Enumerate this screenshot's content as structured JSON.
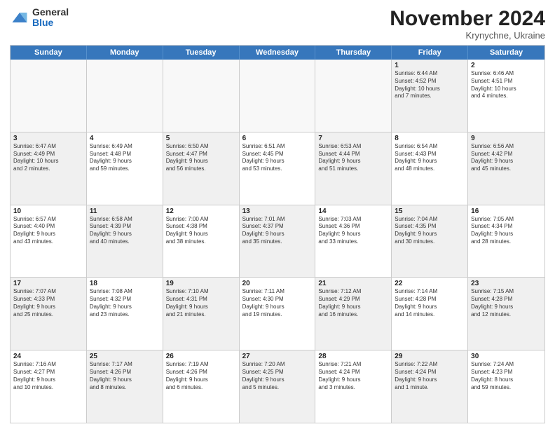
{
  "logo": {
    "general": "General",
    "blue": "Blue"
  },
  "header": {
    "month": "November 2024",
    "location": "Krynychne, Ukraine"
  },
  "days": [
    "Sunday",
    "Monday",
    "Tuesday",
    "Wednesday",
    "Thursday",
    "Friday",
    "Saturday"
  ],
  "rows": [
    [
      {
        "day": "",
        "info": "",
        "empty": true
      },
      {
        "day": "",
        "info": "",
        "empty": true
      },
      {
        "day": "",
        "info": "",
        "empty": true
      },
      {
        "day": "",
        "info": "",
        "empty": true
      },
      {
        "day": "",
        "info": "",
        "empty": true
      },
      {
        "day": "1",
        "info": "Sunrise: 6:44 AM\nSunset: 4:52 PM\nDaylight: 10 hours\nand 7 minutes.",
        "shaded": true
      },
      {
        "day": "2",
        "info": "Sunrise: 6:46 AM\nSunset: 4:51 PM\nDaylight: 10 hours\nand 4 minutes.",
        "shaded": false
      }
    ],
    [
      {
        "day": "3",
        "info": "Sunrise: 6:47 AM\nSunset: 4:49 PM\nDaylight: 10 hours\nand 2 minutes.",
        "shaded": true
      },
      {
        "day": "4",
        "info": "Sunrise: 6:49 AM\nSunset: 4:48 PM\nDaylight: 9 hours\nand 59 minutes.",
        "shaded": false
      },
      {
        "day": "5",
        "info": "Sunrise: 6:50 AM\nSunset: 4:47 PM\nDaylight: 9 hours\nand 56 minutes.",
        "shaded": true
      },
      {
        "day": "6",
        "info": "Sunrise: 6:51 AM\nSunset: 4:45 PM\nDaylight: 9 hours\nand 53 minutes.",
        "shaded": false
      },
      {
        "day": "7",
        "info": "Sunrise: 6:53 AM\nSunset: 4:44 PM\nDaylight: 9 hours\nand 51 minutes.",
        "shaded": true
      },
      {
        "day": "8",
        "info": "Sunrise: 6:54 AM\nSunset: 4:43 PM\nDaylight: 9 hours\nand 48 minutes.",
        "shaded": false
      },
      {
        "day": "9",
        "info": "Sunrise: 6:56 AM\nSunset: 4:42 PM\nDaylight: 9 hours\nand 45 minutes.",
        "shaded": true
      }
    ],
    [
      {
        "day": "10",
        "info": "Sunrise: 6:57 AM\nSunset: 4:40 PM\nDaylight: 9 hours\nand 43 minutes.",
        "shaded": false
      },
      {
        "day": "11",
        "info": "Sunrise: 6:58 AM\nSunset: 4:39 PM\nDaylight: 9 hours\nand 40 minutes.",
        "shaded": true
      },
      {
        "day": "12",
        "info": "Sunrise: 7:00 AM\nSunset: 4:38 PM\nDaylight: 9 hours\nand 38 minutes.",
        "shaded": false
      },
      {
        "day": "13",
        "info": "Sunrise: 7:01 AM\nSunset: 4:37 PM\nDaylight: 9 hours\nand 35 minutes.",
        "shaded": true
      },
      {
        "day": "14",
        "info": "Sunrise: 7:03 AM\nSunset: 4:36 PM\nDaylight: 9 hours\nand 33 minutes.",
        "shaded": false
      },
      {
        "day": "15",
        "info": "Sunrise: 7:04 AM\nSunset: 4:35 PM\nDaylight: 9 hours\nand 30 minutes.",
        "shaded": true
      },
      {
        "day": "16",
        "info": "Sunrise: 7:05 AM\nSunset: 4:34 PM\nDaylight: 9 hours\nand 28 minutes.",
        "shaded": false
      }
    ],
    [
      {
        "day": "17",
        "info": "Sunrise: 7:07 AM\nSunset: 4:33 PM\nDaylight: 9 hours\nand 25 minutes.",
        "shaded": true
      },
      {
        "day": "18",
        "info": "Sunrise: 7:08 AM\nSunset: 4:32 PM\nDaylight: 9 hours\nand 23 minutes.",
        "shaded": false
      },
      {
        "day": "19",
        "info": "Sunrise: 7:10 AM\nSunset: 4:31 PM\nDaylight: 9 hours\nand 21 minutes.",
        "shaded": true
      },
      {
        "day": "20",
        "info": "Sunrise: 7:11 AM\nSunset: 4:30 PM\nDaylight: 9 hours\nand 19 minutes.",
        "shaded": false
      },
      {
        "day": "21",
        "info": "Sunrise: 7:12 AM\nSunset: 4:29 PM\nDaylight: 9 hours\nand 16 minutes.",
        "shaded": true
      },
      {
        "day": "22",
        "info": "Sunrise: 7:14 AM\nSunset: 4:28 PM\nDaylight: 9 hours\nand 14 minutes.",
        "shaded": false
      },
      {
        "day": "23",
        "info": "Sunrise: 7:15 AM\nSunset: 4:28 PM\nDaylight: 9 hours\nand 12 minutes.",
        "shaded": true
      }
    ],
    [
      {
        "day": "24",
        "info": "Sunrise: 7:16 AM\nSunset: 4:27 PM\nDaylight: 9 hours\nand 10 minutes.",
        "shaded": false
      },
      {
        "day": "25",
        "info": "Sunrise: 7:17 AM\nSunset: 4:26 PM\nDaylight: 9 hours\nand 8 minutes.",
        "shaded": true
      },
      {
        "day": "26",
        "info": "Sunrise: 7:19 AM\nSunset: 4:26 PM\nDaylight: 9 hours\nand 6 minutes.",
        "shaded": false
      },
      {
        "day": "27",
        "info": "Sunrise: 7:20 AM\nSunset: 4:25 PM\nDaylight: 9 hours\nand 5 minutes.",
        "shaded": true
      },
      {
        "day": "28",
        "info": "Sunrise: 7:21 AM\nSunset: 4:24 PM\nDaylight: 9 hours\nand 3 minutes.",
        "shaded": false
      },
      {
        "day": "29",
        "info": "Sunrise: 7:22 AM\nSunset: 4:24 PM\nDaylight: 9 hours\nand 1 minute.",
        "shaded": true
      },
      {
        "day": "30",
        "info": "Sunrise: 7:24 AM\nSunset: 4:23 PM\nDaylight: 8 hours\nand 59 minutes.",
        "shaded": false
      }
    ]
  ]
}
